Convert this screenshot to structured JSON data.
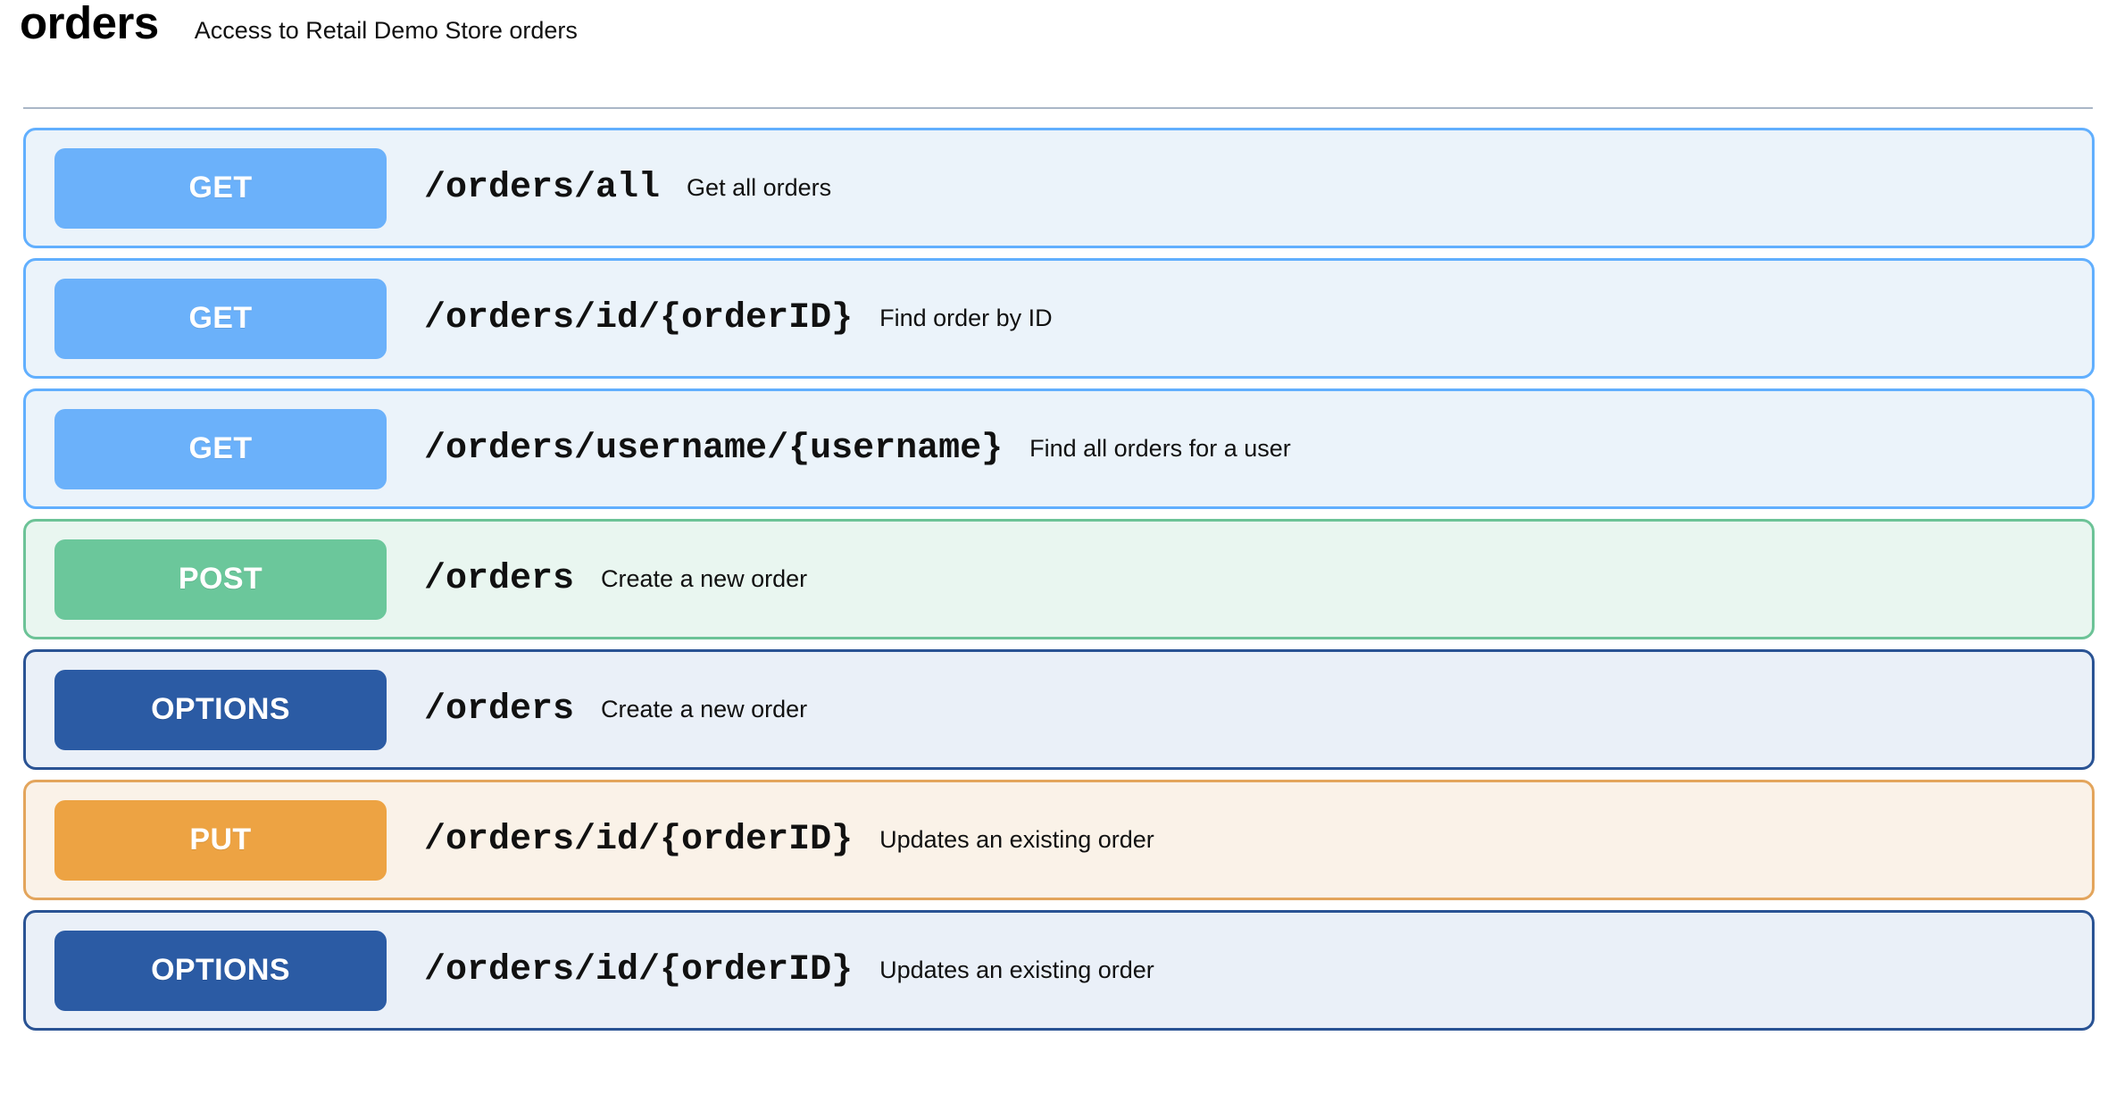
{
  "tag": {
    "name": "orders",
    "description": "Access to Retail Demo Store orders"
  },
  "colors": {
    "divider": "#aab7c7",
    "get_border": "#61affe",
    "get_background": "#ebf3fa",
    "get_button": "#6bb1fa",
    "post_border": "#6cc397",
    "post_background": "#e9f6f0",
    "post_button": "#6bc79b",
    "options_border": "#2a5394",
    "options_background": "#eaf0f8",
    "options_button": "#2b5ba4",
    "put_border": "#e3a55c",
    "put_background": "#faf2e8",
    "put_button": "#eda343"
  },
  "operations": [
    {
      "method": "GET",
      "path": "/orders/all",
      "summary": "Get all orders",
      "border": "#61affe",
      "background": "#ebf3fa",
      "button": "#6bb1fa"
    },
    {
      "method": "GET",
      "path": "/orders/id/{orderID}",
      "summary": "Find order by ID",
      "border": "#61affe",
      "background": "#ebf3fa",
      "button": "#6bb1fa"
    },
    {
      "method": "GET",
      "path": "/orders/username/{username}",
      "summary": "Find all orders for a user",
      "border": "#61affe",
      "background": "#ebf3fa",
      "button": "#6bb1fa"
    },
    {
      "method": "POST",
      "path": "/orders",
      "summary": "Create a new order",
      "border": "#6cc397",
      "background": "#e9f6f0",
      "button": "#6bc79b"
    },
    {
      "method": "OPTIONS",
      "path": "/orders",
      "summary": "Create a new order",
      "border": "#2a5394",
      "background": "#eaf0f8",
      "button": "#2b5ba4"
    },
    {
      "method": "PUT",
      "path": "/orders/id/{orderID}",
      "summary": "Updates an existing order",
      "border": "#e3a55c",
      "background": "#faf2e8",
      "button": "#eda343"
    },
    {
      "method": "OPTIONS",
      "path": "/orders/id/{orderID}",
      "summary": "Updates an existing order",
      "border": "#2a5394",
      "background": "#eaf0f8",
      "button": "#2b5ba4"
    }
  ]
}
